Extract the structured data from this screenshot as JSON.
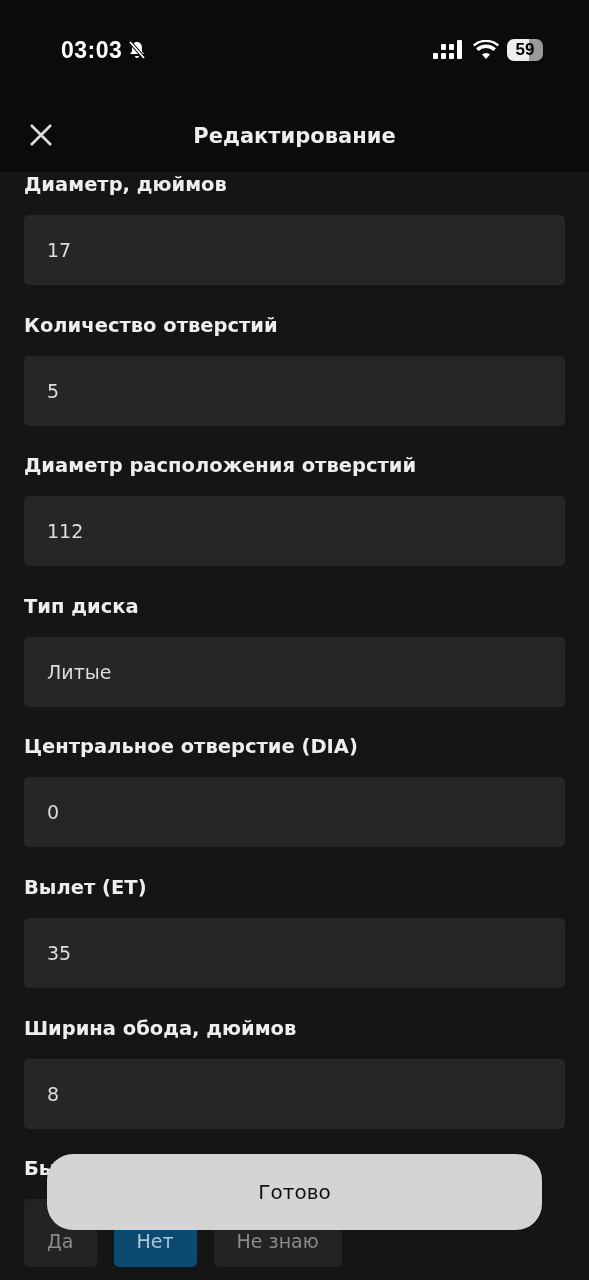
{
  "status_bar": {
    "time": "03:03",
    "battery": "59"
  },
  "header": {
    "title": "Редактирование"
  },
  "fields": [
    {
      "label": "Диаметр, дюймов",
      "value": "17"
    },
    {
      "label": "Количество отверстий",
      "value": "5"
    },
    {
      "label": "Диаметр расположения отверстий",
      "value": "112"
    },
    {
      "label": "Тип диска",
      "value": "Литые"
    },
    {
      "label": "Центральное отверстие (DIA)",
      "value": "0"
    },
    {
      "label": "Вылет (ET)",
      "value": "35"
    },
    {
      "label": "Ширина обода, дюймов",
      "value": "8"
    }
  ],
  "choice": {
    "label": "Бы",
    "options": [
      {
        "label": "Да",
        "selected": false
      },
      {
        "label": "Нет",
        "selected": true
      },
      {
        "label": "Не знаю",
        "selected": false
      }
    ]
  },
  "done_button": {
    "label": "Готово"
  }
}
